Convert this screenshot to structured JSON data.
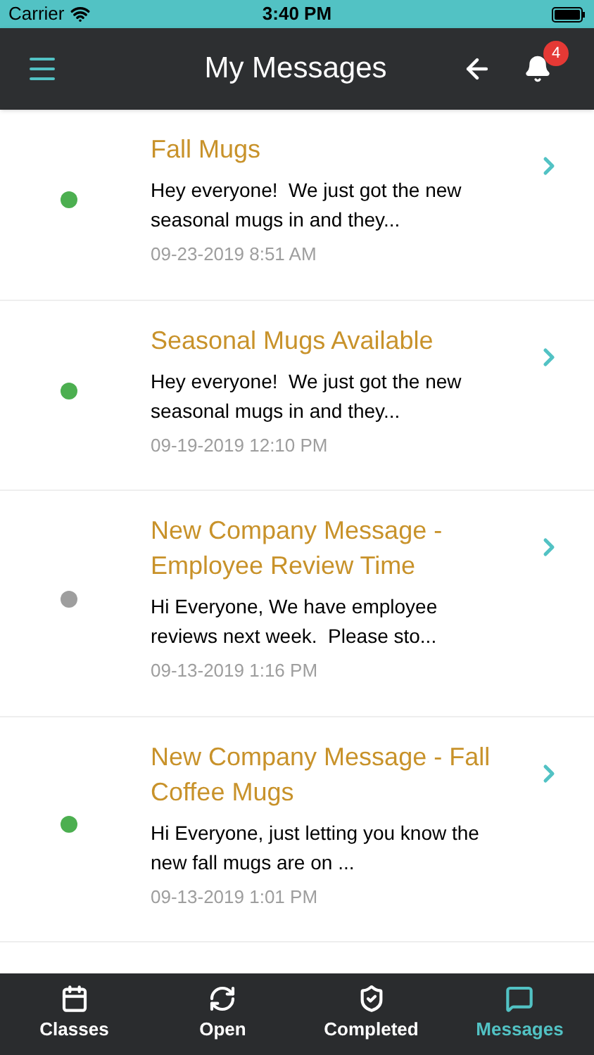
{
  "status_bar": {
    "carrier": "Carrier",
    "time": "3:40 PM"
  },
  "header": {
    "title": "My Messages",
    "notification_count": "4"
  },
  "messages": [
    {
      "title": "Fall Mugs",
      "preview": "Hey everyone!  We just got the new seasonal mugs in and they...",
      "date": "09-23-2019 8:51 AM",
      "color": "#4caf50"
    },
    {
      "title": "Seasonal Mugs Available",
      "preview": "Hey everyone!  We just got the new seasonal mugs in and they...",
      "date": "09-19-2019 12:10 PM",
      "color": "#4caf50"
    },
    {
      "title": "New Company Message - Employee Review Time",
      "preview": "Hi Everyone, We have employee reviews next week.  Please sto...",
      "date": "09-13-2019 1:16 PM",
      "color": "#9e9e9e"
    },
    {
      "title": "New Company Message - Fall Coffee Mugs",
      "preview": "Hi Everyone, just letting you know the new fall mugs are on ...",
      "date": "09-13-2019 1:01 PM",
      "color": "#4caf50"
    }
  ],
  "tabs": [
    {
      "kind": "calendar",
      "label": "Classes",
      "selected": false
    },
    {
      "kind": "refresh",
      "label": "Open",
      "selected": false
    },
    {
      "kind": "shield",
      "label": "Completed",
      "selected": false
    },
    {
      "kind": "chat",
      "label": "Messages",
      "selected": true
    }
  ]
}
